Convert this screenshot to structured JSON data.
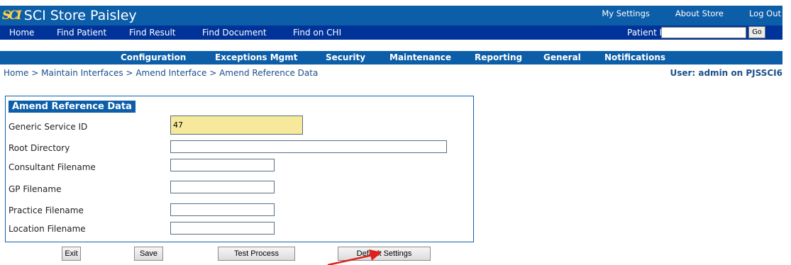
{
  "header": {
    "logo_mark": "SCI",
    "title": "SCI Store Paisley",
    "links": [
      "My Settings",
      "About Store",
      "Log Out"
    ]
  },
  "nav": {
    "items": [
      "Home",
      "Find Patient",
      "Find Result",
      "Find Document",
      "Find on CHI"
    ],
    "patient_id_label": "Patient ID:",
    "patient_id_value": "",
    "go_label": "Go"
  },
  "subnav": {
    "items": [
      "Configuration",
      "Exceptions Mgmt",
      "Security",
      "Maintenance",
      "Reporting",
      "General",
      "Notifications"
    ]
  },
  "breadcrumb": {
    "items": [
      "Home",
      "Maintain Interfaces",
      "Amend Interface",
      "Amend Reference Data"
    ],
    "separator": ">"
  },
  "user_info": "User: admin on PJSSCI6",
  "form": {
    "title": "Amend Reference Data",
    "fields": [
      {
        "label": "Generic Service ID",
        "value": "47"
      },
      {
        "label": "Root Directory",
        "value": ""
      },
      {
        "label": "Consultant Filename",
        "value": ""
      },
      {
        "label": "GP Filename",
        "value": ""
      },
      {
        "label": "Practice Filename",
        "value": ""
      },
      {
        "label": "Location Filename",
        "value": ""
      }
    ]
  },
  "buttons": {
    "exit": "Exit",
    "save": "Save",
    "test_process": "Test Process",
    "default_settings": "Default Settings"
  },
  "colors": {
    "header_bg": "#0d5ea8",
    "nav_bg": "#003399",
    "readonly_bg": "#f6e99b",
    "annotation_arrow": "#e0201b"
  }
}
